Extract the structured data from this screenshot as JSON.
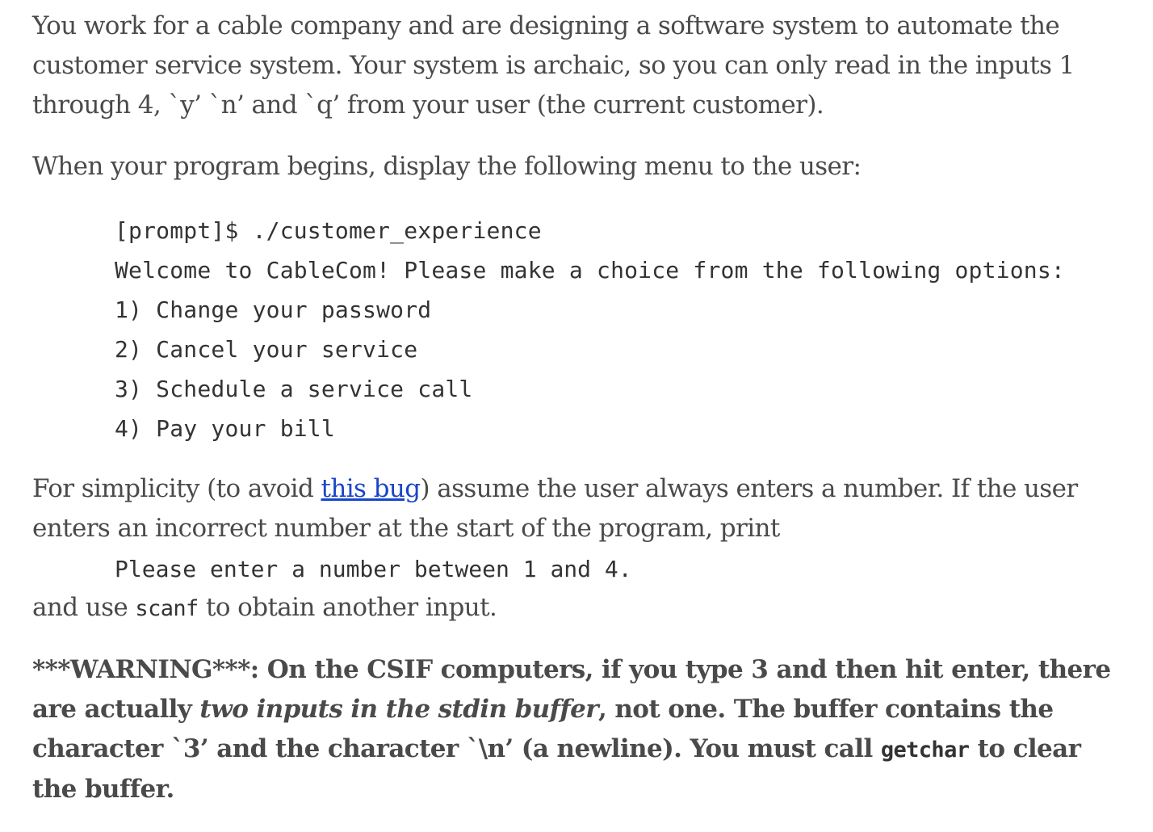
{
  "intro": {
    "text": "You work for a cable company and are designing a software system to automate the customer service system. Your system is archaic, so you can only read in the inputs 1 through 4, `y’ `n’ and `q’ from your user (the current customer)."
  },
  "menu_intro": {
    "text": "When your program begins, display the following menu to the user:"
  },
  "terminal": {
    "lines": [
      "[prompt]$ ./customer_experience",
      "Welcome to CableCom! Please make a choice from the following options:",
      "1) Change your password",
      "2) Cancel your service",
      "3) Schedule a service call",
      "4) Pay your bill"
    ]
  },
  "simplicity": {
    "before_link": "For simplicity (to avoid ",
    "link_text": "this bug",
    "after_link": ") assume the user always enters a number. If the user enters an incorrect number at the start of the program, print"
  },
  "error_message": "Please enter a number between 1 and 4.",
  "scanf_line": {
    "before": "and use ",
    "code": "scanf",
    "after": " to obtain another input."
  },
  "warning": {
    "part1": "***WARNING***: On the CSIF computers, if you type 3 and then hit enter, there are actually ",
    "emphasis": "two inputs in the stdin buffer",
    "part2": ", not one. The buffer contains the character `3’ and the character `\\n’ (a newline). You must call ",
    "code": "getchar",
    "part3": " to clear the buffer."
  }
}
